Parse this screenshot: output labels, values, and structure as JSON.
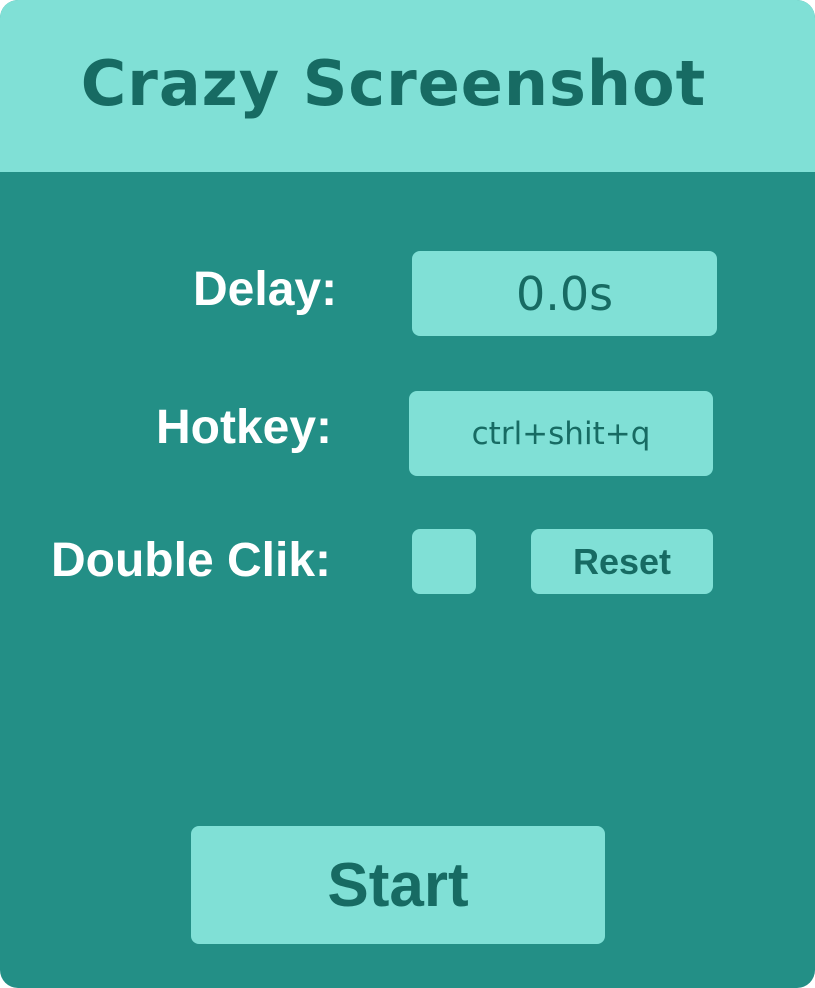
{
  "app": {
    "title": "Crazy Screenshot"
  },
  "settings": {
    "delay_label": "Delay:",
    "delay_value": "0.0s",
    "hotkey_label": "Hotkey:",
    "hotkey_value": "ctrl+shit+q",
    "double_click_label": "Double Clik:",
    "double_click_checked": false,
    "reset_label": "Reset"
  },
  "actions": {
    "start_label": "Start"
  },
  "colors": {
    "panel_bg": "#238f86",
    "accent_bg": "#80e0d6",
    "accent_text": "#176b63",
    "label_text": "#ffffff"
  }
}
